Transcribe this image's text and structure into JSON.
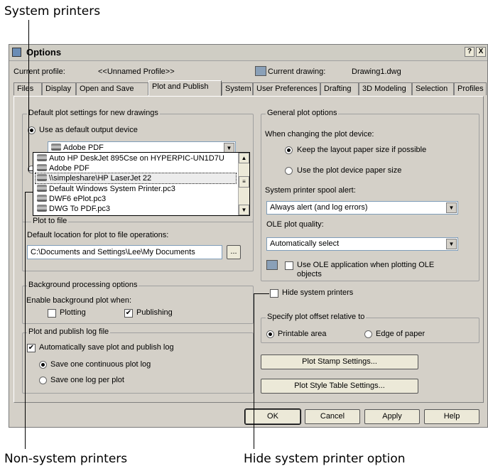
{
  "callouts": {
    "system_printers": "System printers",
    "non_system_printers": "Non-system printers",
    "hide_system_printer_option": "Hide system printer option"
  },
  "dialog": {
    "title": "Options",
    "help_btn": "?",
    "close_btn": "X",
    "current_profile_label": "Current profile:",
    "current_profile_value": "<<Unnamed Profile>>",
    "current_drawing_label": "Current drawing:",
    "current_drawing_value": "Drawing1.dwg"
  },
  "tabs": [
    {
      "label": "Files"
    },
    {
      "label": "Display"
    },
    {
      "label": "Open and Save"
    },
    {
      "label": "Plot and Publish"
    },
    {
      "label": "System"
    },
    {
      "label": "User Preferences"
    },
    {
      "label": "Drafting"
    },
    {
      "label": "3D Modeling"
    },
    {
      "label": "Selection"
    },
    {
      "label": "Profiles"
    }
  ],
  "active_tab": "Plot and Publish",
  "default_plot": {
    "title": "Default plot settings for new drawings",
    "use_default_label": "Use as default output device",
    "device_value": "Adobe PDF",
    "dropdown_items": [
      "Auto HP DeskJet 895Cse on HYPERPIC-UN1D7U",
      "Adobe PDF",
      "\\\\simpleshare\\HP LaserJet 22",
      "Default Windows System Printer.pc3",
      "DWF6 ePlot.pc3",
      "DWG To PDF.pc3"
    ]
  },
  "plot_to_file": {
    "title": "Plot to file",
    "location_label": "Default location for plot to file operations:",
    "location_value": "C:\\Documents and Settings\\Lee\\My Documents",
    "browse_label": "..."
  },
  "background": {
    "title": "Background processing options",
    "enable_label": "Enable background plot when:",
    "plotting_label": "Plotting",
    "plotting_checked": false,
    "publishing_label": "Publishing",
    "publishing_checked": true
  },
  "log": {
    "title": "Plot and publish log file",
    "auto_save_label": "Automatically save plot and publish log",
    "auto_save_checked": true,
    "continuous_label": "Save one continuous plot log",
    "per_plot_label": "Save one log per plot"
  },
  "general": {
    "title": "General plot options",
    "when_changing_label": "When changing the plot device:",
    "keep_layout_label": "Keep the layout paper size if possible",
    "use_device_label": "Use the plot device paper size",
    "spool_label": "System printer spool alert:",
    "spool_value": "Always alert (and log errors)",
    "ole_quality_label": "OLE plot quality:",
    "ole_quality_value": "Automatically select",
    "use_ole_label": "Use OLE application when plotting OLE",
    "use_ole_label_2": "objects",
    "hide_system_label": "Hide system printers"
  },
  "offset": {
    "title": "Specify plot offset relative to",
    "printable_label": "Printable area",
    "edge_label": "Edge of paper"
  },
  "buttons": {
    "plot_stamp": "Plot Stamp Settings...",
    "plot_style": "Plot Style Table Settings...",
    "ok": "OK",
    "cancel": "Cancel",
    "apply": "Apply",
    "help": "Help"
  }
}
